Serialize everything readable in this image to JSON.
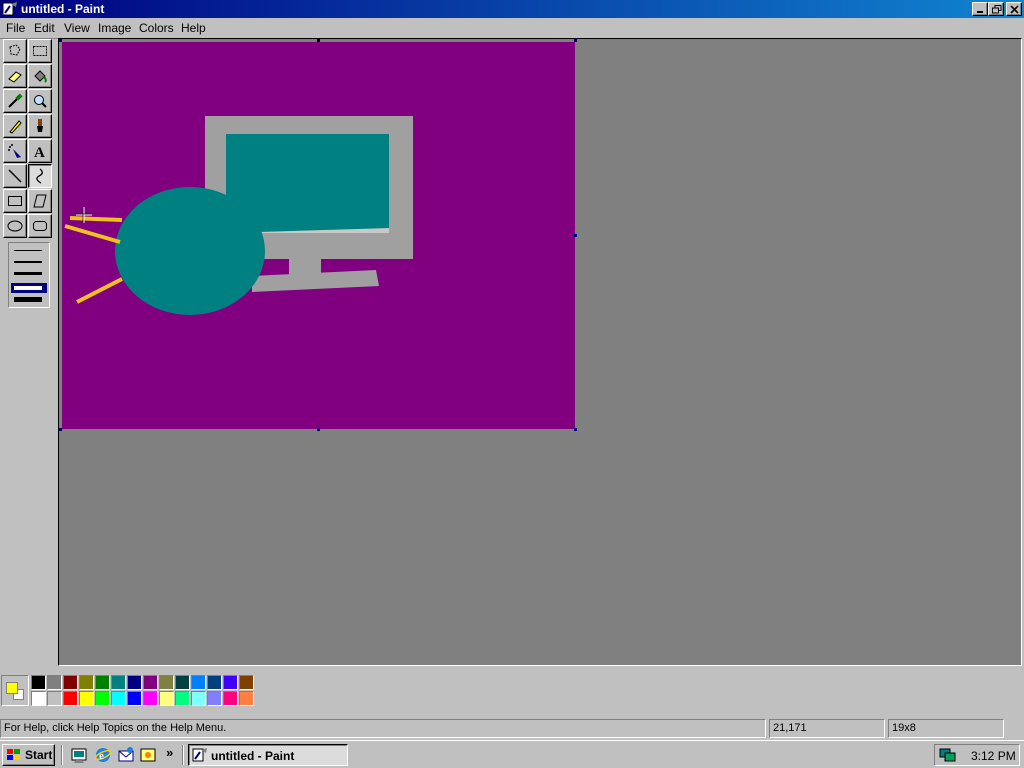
{
  "window": {
    "title": "untitled - Paint"
  },
  "menubar": {
    "items": [
      "File",
      "Edit",
      "View",
      "Image",
      "Colors",
      "Help"
    ]
  },
  "toolbox": {
    "tools": [
      "free-form-select",
      "select",
      "eraser",
      "fill-with-color",
      "pick-color",
      "magnifier",
      "pencil",
      "brush",
      "airbrush",
      "text",
      "line",
      "curve",
      "rectangle",
      "polygon",
      "ellipse",
      "rounded-rectangle"
    ],
    "selected_tool": "curve",
    "line_widths": [
      1,
      2,
      3,
      4,
      5
    ],
    "selected_line_width": 4
  },
  "canvas": {
    "background_color": "#800080",
    "shapes": [
      {
        "kind": "monitor-frame",
        "color": "#a0a0a0"
      },
      {
        "kind": "monitor-screen",
        "color": "#008080"
      },
      {
        "kind": "monitor-stand",
        "color": "#a0a0a0"
      },
      {
        "kind": "ellipse",
        "color": "#008080"
      },
      {
        "kind": "curve-lines",
        "color": "#f0c020"
      }
    ]
  },
  "palette": {
    "foreground": "#ffff00",
    "background": "#ffffff",
    "top_row": [
      "#000000",
      "#808080",
      "#800000",
      "#808000",
      "#008000",
      "#008080",
      "#000080",
      "#800080",
      "#808040",
      "#004040",
      "#0080ff",
      "#004080",
      "#4000ff",
      "#804000"
    ],
    "bottom_row": [
      "#ffffff",
      "#c0c0c0",
      "#ff0000",
      "#ffff00",
      "#00ff00",
      "#00ffff",
      "#0000ff",
      "#ff00ff",
      "#ffff80",
      "#00ff80",
      "#80ffff",
      "#8080ff",
      "#ff0080",
      "#ff8040"
    ]
  },
  "statusbar": {
    "help_text": "For Help, click Help Topics on the Help Menu.",
    "coordinates": "21,171",
    "selection_size": "19x8"
  },
  "taskbar": {
    "start_label": "Start",
    "quick_launch": [
      "show-desktop-icon",
      "internet-explorer-icon",
      "outlook-express-icon",
      "channels-icon"
    ],
    "more_label": "»",
    "task_label": "untitled - Paint",
    "clock": "3:12 PM"
  }
}
